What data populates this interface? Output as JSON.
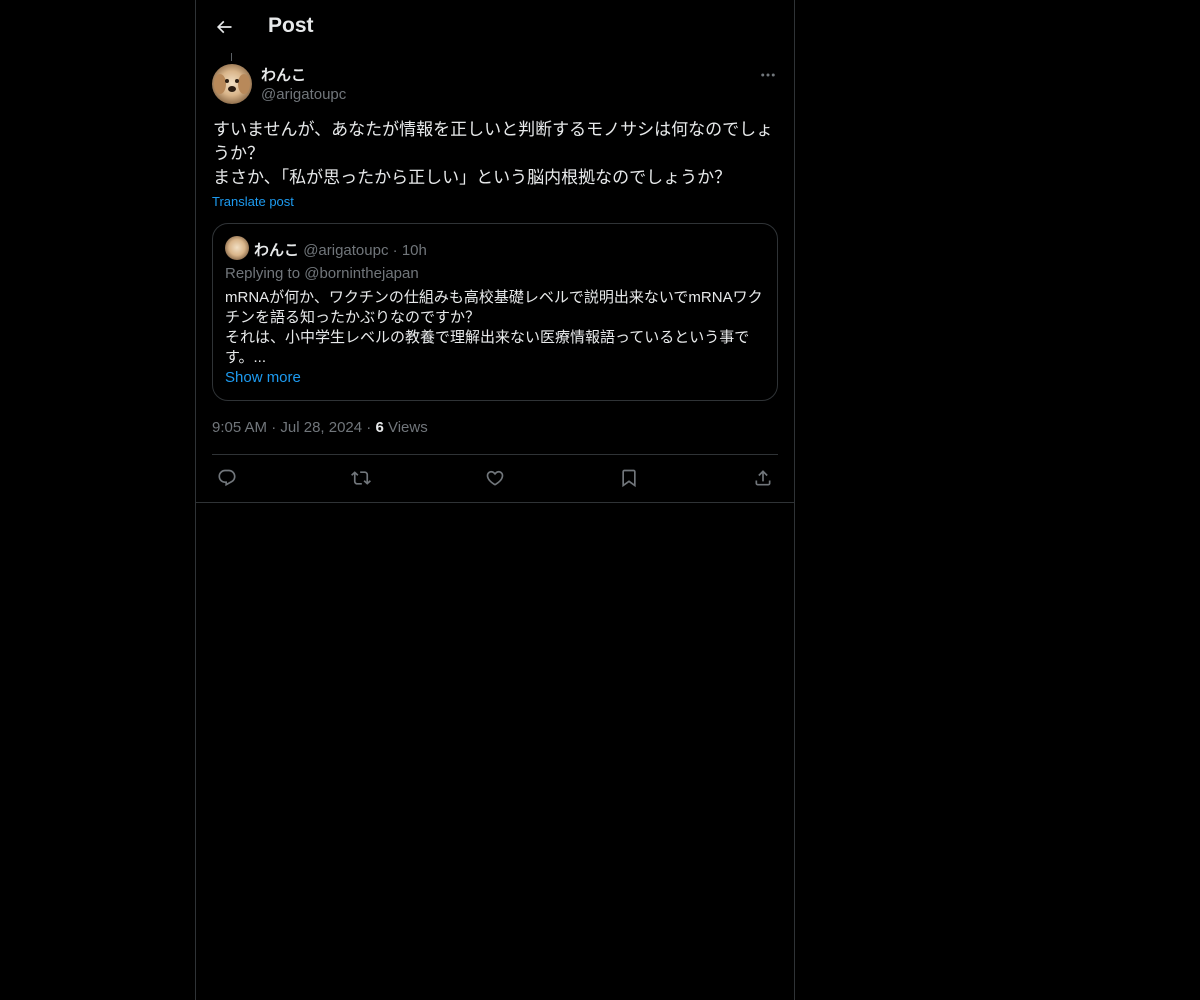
{
  "header": {
    "title": "Post"
  },
  "post": {
    "author": {
      "name": "わんこ",
      "handle": "@arigatoupc"
    },
    "text": "すいませんが、あなたが情報を正しいと判断するモノサシは何なのでしょうか？\nまさか、「私が思ったから正しい」という脳内根拠なのでしょうか？",
    "translate_label": "Translate post",
    "quote": {
      "name": "わんこ",
      "handle": "@arigatoupc",
      "separator": "·",
      "time": "10h",
      "replying_to": "Replying to @borninthejapan",
      "text": "mRNAが何か、ワクチンの仕組みも高校基礎レベルで説明出来ないでmRNAワクチンを語る知ったかぶりなのですか？\nそれは、小中学生レベルの教養で理解出来ない医療情報語っているという事です。...",
      "show_more": "Show more"
    },
    "meta": {
      "time": "9:05 AM",
      "separator": "·",
      "date": "Jul 28, 2024",
      "views_count": "6",
      "views_label": "Views"
    }
  },
  "icons": {
    "back": "arrow-left-icon",
    "more": "more-horizontal-icon",
    "reply": "reply-icon",
    "repost": "repost-icon",
    "like": "heart-icon",
    "bookmark": "bookmark-icon",
    "share": "share-icon"
  },
  "colors": {
    "background": "#000000",
    "text": "#e7e9ea",
    "secondary": "#71767b",
    "accent": "#1d9bf0",
    "border": "#2f3336"
  }
}
